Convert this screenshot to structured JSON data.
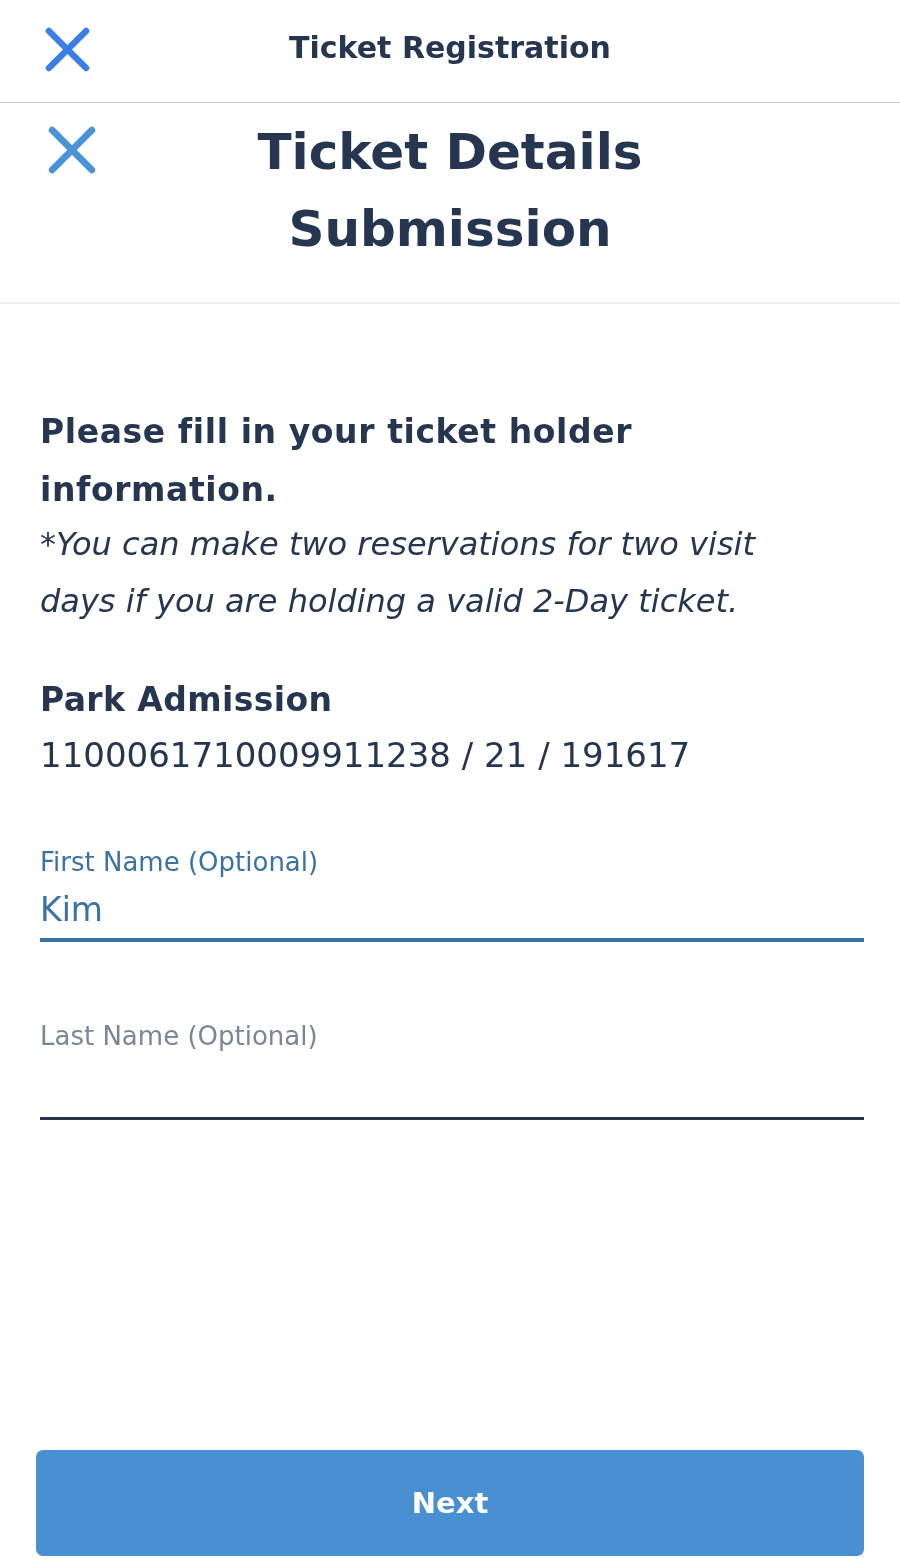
{
  "top_bar": {
    "title": "Ticket Registration"
  },
  "header": {
    "title": "Ticket Details Submission"
  },
  "intro": {
    "heading": "Please fill in your ticket holder information.",
    "note": "*You can make two reservations for two visit days if you are holding a valid 2-Day ticket."
  },
  "admission": {
    "label": "Park Admission",
    "value": "1100061710009911238 / 21 / 191617"
  },
  "fields": [
    {
      "label": "First Name (Optional)",
      "value": "Kim",
      "focused": true
    },
    {
      "label": "Last Name (Optional)",
      "focused": false
    }
  ],
  "next_button": {
    "label": "Next"
  }
}
